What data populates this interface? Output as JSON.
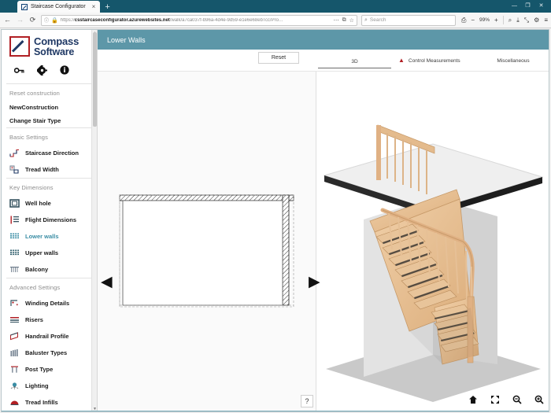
{
  "browser": {
    "tab_title": "Staircase Configurator",
    "tab_close": "×",
    "new_tab": "+",
    "window_minimize": "—",
    "window_maximize": "❐",
    "window_close": "✕",
    "back": "←",
    "forward": "→",
    "reload": "⟳",
    "site_info_icon": "ⓘ",
    "lock_icon": "🔒",
    "url_scheme": "https://",
    "url_host": "csstaircaseconfigurator.azurewebsites.net",
    "url_path": "/walk/a7ca037f-b96a-4d4e-9d59-e1e6e68ebTcc/Pro…",
    "url_overflow": "⋯",
    "bookmark_icon": "☆",
    "reader_icon": "⧉",
    "search_placeholder": "Search",
    "search_icon": "⌕",
    "print_icon": "⎙",
    "zoom_out": "−",
    "zoom_level": "99%",
    "zoom_in": "+",
    "find_icon": "⌕",
    "save_icon": "⤓",
    "fullscreen_icon": "⤡",
    "settings_icon": "⚙",
    "menu_icon": "≡"
  },
  "sidebar": {
    "logo_line1": "Compass",
    "logo_line2": "Software",
    "tools": [
      {
        "name": "key-icon",
        "glyph": "⚷"
      },
      {
        "name": "gear-icon",
        "glyph": "⚙"
      },
      {
        "name": "info-icon",
        "glyph": "ℹ"
      }
    ],
    "reset_label": "Reset construction",
    "new_construction": "NewConstruction",
    "change_stair_type": "Change Stair Type",
    "group_basic": "Basic Settings",
    "group_key": "Key Dimensions",
    "group_advanced": "Advanced Settings",
    "items_basic": [
      {
        "label": "Staircase Direction",
        "icon": "staircase-direction-icon"
      },
      {
        "label": "Tread Width",
        "icon": "tread-width-icon"
      }
    ],
    "items_key": [
      {
        "label": "Well hole",
        "icon": "well-hole-icon"
      },
      {
        "label": "Flight Dimensions",
        "icon": "flight-dimensions-icon"
      },
      {
        "label": "Lower walls",
        "icon": "lower-walls-icon"
      },
      {
        "label": "Upper walls",
        "icon": "upper-walls-icon"
      },
      {
        "label": "Balcony",
        "icon": "balcony-icon"
      }
    ],
    "items_advanced": [
      {
        "label": "Winding Details",
        "icon": "winding-details-icon"
      },
      {
        "label": "Risers",
        "icon": "risers-icon"
      },
      {
        "label": "Handrail Profile",
        "icon": "handrail-profile-icon"
      },
      {
        "label": "Baluster Types",
        "icon": "baluster-types-icon"
      },
      {
        "label": "Post Type",
        "icon": "post-type-icon"
      },
      {
        "label": "Lighting",
        "icon": "lighting-icon"
      },
      {
        "label": "Tread Infills",
        "icon": "tread-infills-icon"
      }
    ],
    "active_item": "Lower walls",
    "accent_active": "#3b8ea5"
  },
  "main": {
    "header_title": "Lower Walls",
    "header_color": "#5d97a8",
    "reset_button": "Reset",
    "tabs": [
      {
        "label": "3D",
        "active": true,
        "warning": false
      },
      {
        "label": "Control Measurements",
        "active": false,
        "warning": true
      },
      {
        "label": "Miscellaneous",
        "active": false,
        "warning": false
      }
    ],
    "warning_icon": "⚠",
    "warning_color": "#b11f24",
    "nav_prev": "◀",
    "nav_next": "▶",
    "help_button": "?",
    "view_tools": [
      {
        "name": "home-icon",
        "glyph": "⌂"
      },
      {
        "name": "fit-screen-icon",
        "glyph": "⤢"
      },
      {
        "name": "zoom-out-icon",
        "glyph": "⌕"
      },
      {
        "name": "zoom-in-icon",
        "glyph": "⌕"
      }
    ]
  }
}
